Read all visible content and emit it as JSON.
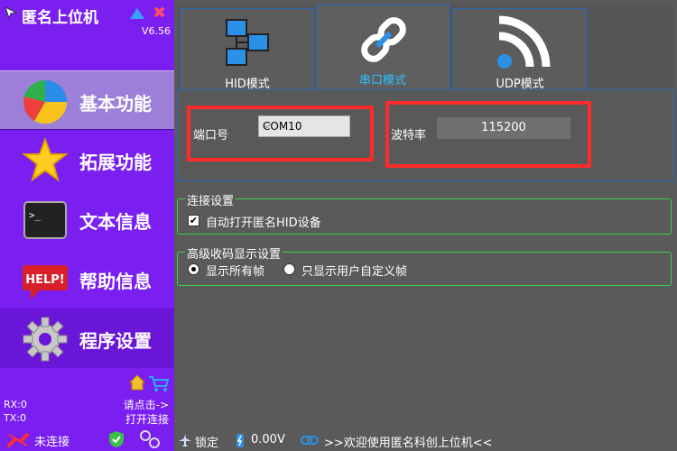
{
  "app": {
    "title": "匿名上位机",
    "version": "V6.56"
  },
  "sidebar": {
    "items": [
      {
        "label": "基本功能",
        "icon": "pie-chart-icon"
      },
      {
        "label": "拓展功能",
        "icon": "star-icon"
      },
      {
        "label": "文本信息",
        "icon": "terminal-icon"
      },
      {
        "label": "帮助信息",
        "icon": "help-icon"
      },
      {
        "label": "程序设置",
        "icon": "gear-icon"
      }
    ],
    "rx": "RX:0",
    "tx": "TX:0",
    "hint_line1": "请点击->",
    "hint_line2": "打开连接",
    "connection": "未连接"
  },
  "tabs": [
    {
      "label": "HID模式"
    },
    {
      "label": "串口模式"
    },
    {
      "label": "UDP模式"
    }
  ],
  "serial": {
    "port_label": "端口号",
    "port_value": "COM10",
    "baud_label": "波特率",
    "baud_value": "115200"
  },
  "conn_settings": {
    "title": "连接设置",
    "auto_open": "自动打开匿名HID设备"
  },
  "advanced": {
    "title": "高级收码显示设置",
    "show_all": "显示所有帧",
    "show_custom": "只显示用户自定义帧"
  },
  "status": {
    "lock": "锁定",
    "voltage": "0.00V",
    "welcome": ">>欢迎使用匿名科创上位机<<"
  },
  "colors": {
    "sidebar": "#7a1ff0",
    "active_tab": "#2cc0ff",
    "highlight": "#ff2a2a",
    "group_border": "#39d048"
  }
}
